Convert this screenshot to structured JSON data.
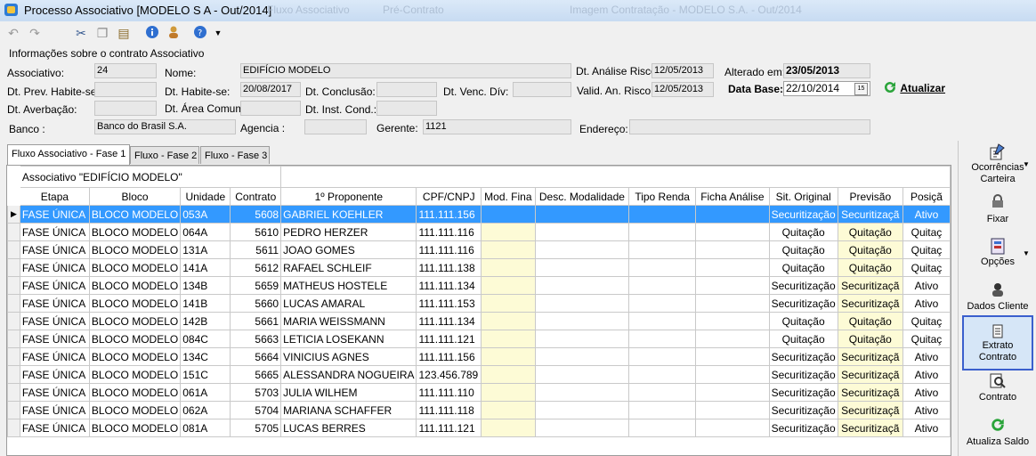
{
  "window": {
    "title": "Processo Associativo [MODELO S A - Out/2014]",
    "ghost_tabs": [
      "Fluxo Associativo",
      "Pré-Contrato",
      "Imagem Contratação - MODELO S.A. - Out/2014"
    ]
  },
  "toolbar": {
    "icons": [
      "undo-icon",
      "redo-icon",
      "cut-icon",
      "copy-icon",
      "paste-icon",
      "info-icon",
      "user-icon",
      "help-icon",
      "dropdown-arrow-icon"
    ]
  },
  "form": {
    "section_title": "Informações sobre o contrato Associativo",
    "associativo_label": "Associativo:",
    "associativo_value": "24",
    "nome_label": "Nome:",
    "nome_value": "EDIFÍCIO MODELO",
    "dt_analise_risco_label": "Dt. Análise Risco:",
    "dt_analise_risco_value": "12/05/2013",
    "alterado_em_label": "Alterado em:",
    "alterado_em_value": "23/05/2013",
    "dt_prev_habite_label": "Dt. Prev. Habite-se:",
    "dt_prev_habite_value": "",
    "dt_habite_label": "Dt. Habite-se:",
    "dt_habite_value": "20/08/2017",
    "dt_conclusao_label": "Dt. Conclusão:",
    "dt_conclusao_value": "",
    "dt_venc_div_label": "Dt. Venc. Dív:",
    "dt_venc_div_value": "",
    "valid_an_risco_label": "Valid. An. Risco:",
    "valid_an_risco_value": "12/05/2013",
    "data_base_label": "Data Base:",
    "data_base_value": "22/10/2014",
    "dt_averbacao_label": "Dt. Averbação:",
    "dt_averbacao_value": "",
    "dt_area_comum_label": "Dt. Área Comum:",
    "dt_area_comum_value": "",
    "dt_inst_cond_label": "Dt. Inst. Cond.:",
    "dt_inst_cond_value": "",
    "banco_label": "Banco :",
    "banco_value": "Banco do Brasil S.A.",
    "agencia_label": "Agencia :",
    "agencia_value": "",
    "gerente_label": "Gerente:",
    "gerente_value": "1121",
    "endereco_label": "Endereço:",
    "endereco_value": "",
    "atualizar_label": "Atualizar"
  },
  "tabs": [
    "Fluxo Associativo - Fase 1",
    "Fluxo - Fase 2",
    "Fluxo - Fase 3"
  ],
  "grid": {
    "group_header": "Associativo \"EDIFÍCIO MODELO\"",
    "columns": [
      "Etapa",
      "Bloco",
      "Unidade",
      "Contrato",
      "1º Proponente",
      "CPF/CNPJ",
      "Mod. Fina",
      "Desc. Modalidade",
      "Tipo Renda",
      "Ficha Análise",
      "Sit. Original",
      "Previsão",
      "Posiçã"
    ],
    "rows": [
      [
        "FASE ÚNICA",
        "BLOCO MODELO",
        "053A",
        "5608",
        "GABRIEL KOEHLER",
        "111.111.156",
        "",
        "",
        "",
        "",
        "Securitização",
        "Securitizaçã",
        "Ativo"
      ],
      [
        "FASE ÚNICA",
        "BLOCO MODELO",
        "064A",
        "5610",
        "PEDRO HERZER",
        "111.111.116",
        "",
        "",
        "",
        "",
        "Quitação",
        "Quitação",
        "Quitaç"
      ],
      [
        "FASE ÚNICA",
        "BLOCO MODELO",
        "131A",
        "5611",
        "JOAO GOMES",
        "111.111.116",
        "",
        "",
        "",
        "",
        "Quitação",
        "Quitação",
        "Quitaç"
      ],
      [
        "FASE ÚNICA",
        "BLOCO MODELO",
        "141A",
        "5612",
        "RAFAEL SCHLEIF",
        "111.111.138",
        "",
        "",
        "",
        "",
        "Quitação",
        "Quitação",
        "Quitaç"
      ],
      [
        "FASE ÚNICA",
        "BLOCO MODELO",
        "134B",
        "5659",
        "MATHEUS HOSTELE",
        "111.111.134",
        "",
        "",
        "",
        "",
        "Securitização",
        "Securitizaçã",
        "Ativo"
      ],
      [
        "FASE ÚNICA",
        "BLOCO MODELO",
        "141B",
        "5660",
        "LUCAS AMARAL",
        "111.111.153",
        "",
        "",
        "",
        "",
        "Securitização",
        "Securitizaçã",
        "Ativo"
      ],
      [
        "FASE ÚNICA",
        "BLOCO MODELO",
        "142B",
        "5661",
        "MARIA WEISSMANN",
        "111.111.134",
        "",
        "",
        "",
        "",
        "Quitação",
        "Quitação",
        "Quitaç"
      ],
      [
        "FASE ÚNICA",
        "BLOCO MODELO",
        "084C",
        "5663",
        "LETICIA LOSEKANN",
        "111.111.121",
        "",
        "",
        "",
        "",
        "Quitação",
        "Quitação",
        "Quitaç"
      ],
      [
        "FASE ÚNICA",
        "BLOCO MODELO",
        "134C",
        "5664",
        "VINICIUS AGNES",
        "111.111.156",
        "",
        "",
        "",
        "",
        "Securitização",
        "Securitizaçã",
        "Ativo"
      ],
      [
        "FASE ÚNICA",
        "BLOCO MODELO",
        "151C",
        "5665",
        "ALESSANDRA NOGUEIRA",
        "123.456.789",
        "",
        "",
        "",
        "",
        "Securitização",
        "Securitizaçã",
        "Ativo"
      ],
      [
        "FASE ÚNICA",
        "BLOCO MODELO",
        "061A",
        "5703",
        "JULIA WILHEM",
        "111.111.110",
        "",
        "",
        "",
        "",
        "Securitização",
        "Securitizaçã",
        "Ativo"
      ],
      [
        "FASE ÚNICA",
        "BLOCO MODELO",
        "062A",
        "5704",
        "MARIANA SCHAFFER",
        "111.111.118",
        "",
        "",
        "",
        "",
        "Securitização",
        "Securitizaçã",
        "Ativo"
      ],
      [
        "FASE ÚNICA",
        "BLOCO MODELO",
        "081A",
        "5705",
        "LUCAS BERRES",
        "111.111.121",
        "",
        "",
        "",
        "",
        "Securitização",
        "Securitizaçã",
        "Ativo"
      ]
    ]
  },
  "side_panel": {
    "ocorrencias": "Ocorrências Carteira",
    "fixar": "Fixar",
    "opcoes": "Opções",
    "dados_cliente": "Dados Cliente",
    "extrato_contrato": "Extrato Contrato",
    "contrato": "Contrato",
    "atualiza_saldo": "Atualiza Saldo"
  },
  "colors": {
    "selection": "#3399ff",
    "highlight_cell": "#fdfbd6",
    "panel_highlight": "#3a5fcd"
  }
}
